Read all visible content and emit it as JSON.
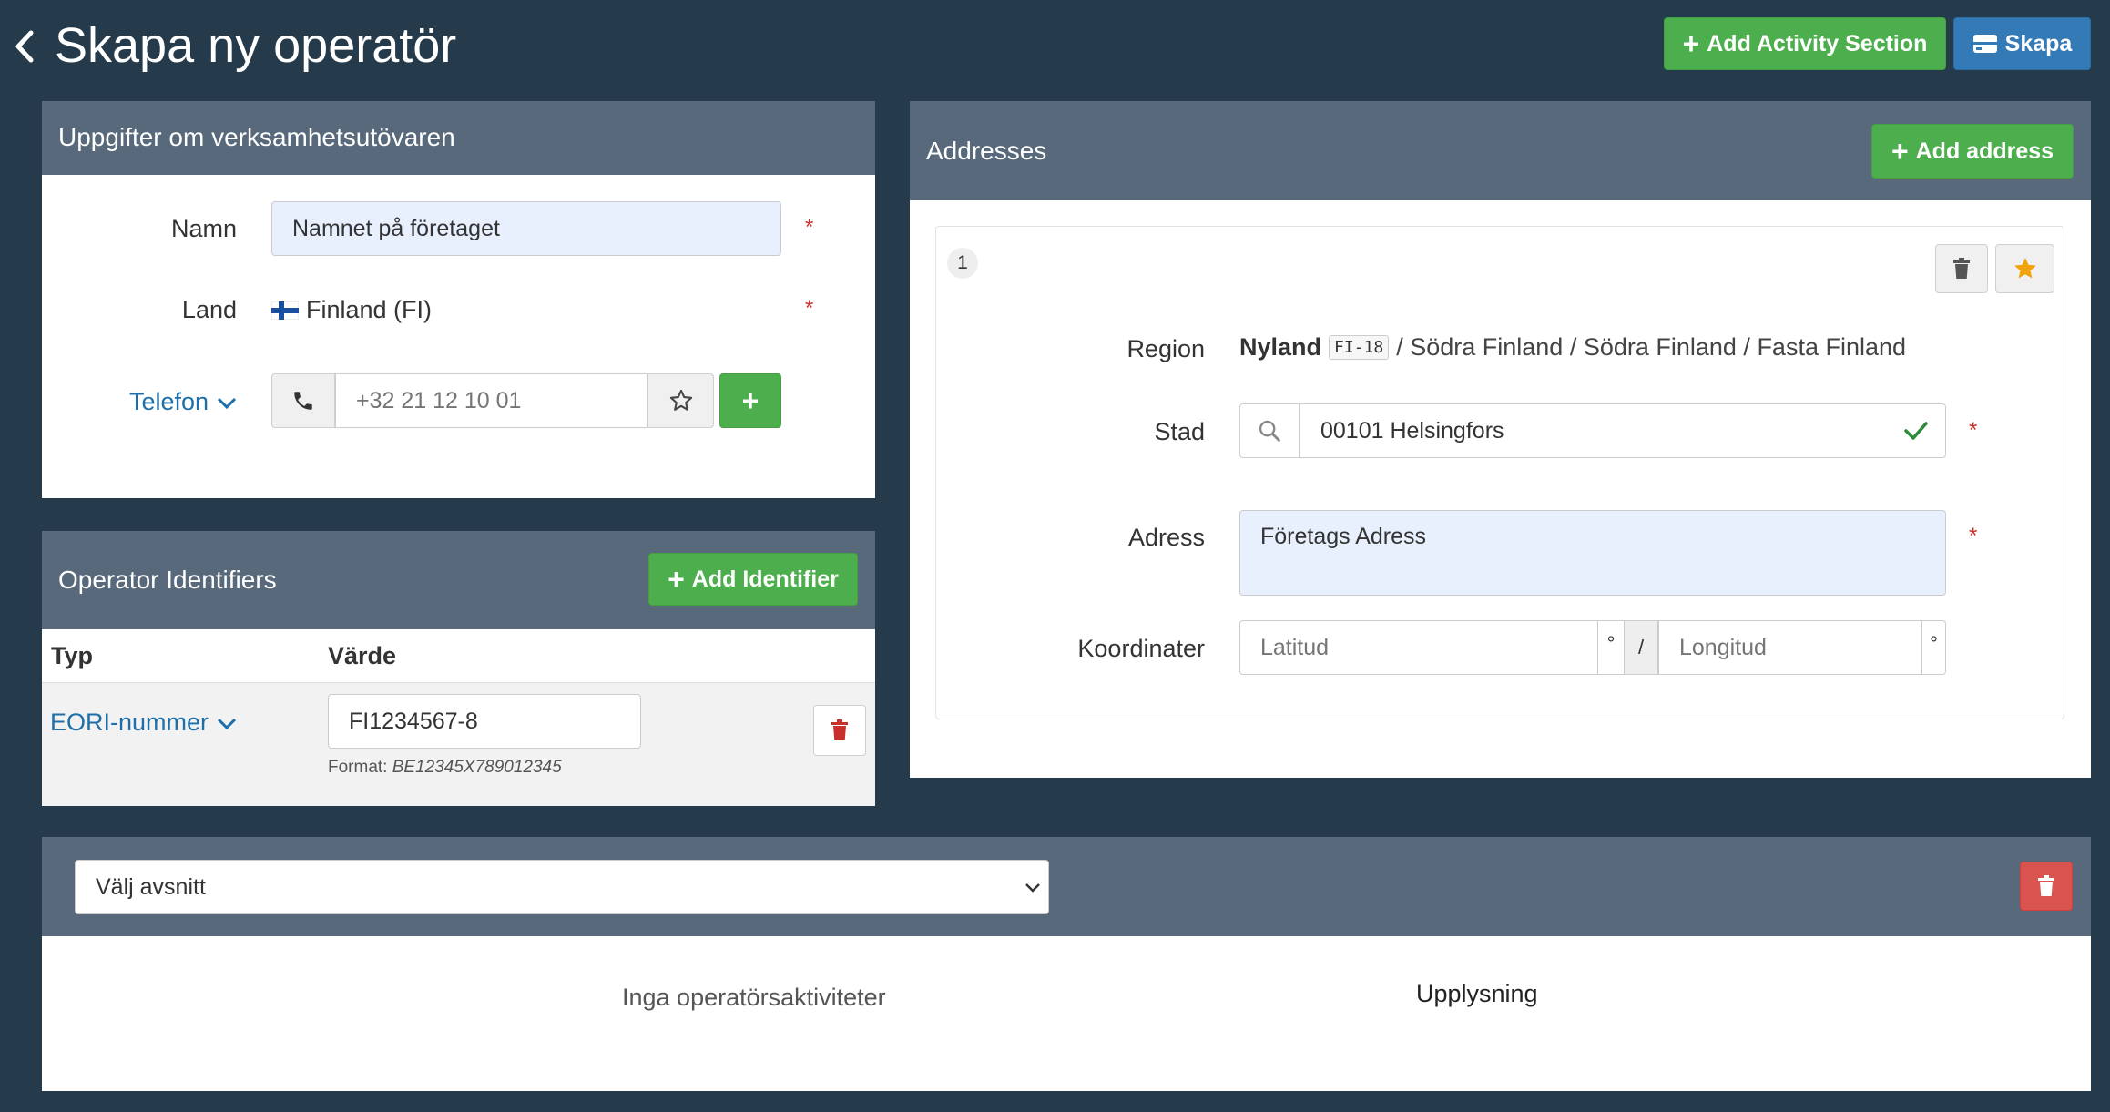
{
  "header": {
    "title": "Skapa ny operatör",
    "add_activity_label": "Add Activity Section",
    "create_label": "Skapa"
  },
  "operator": {
    "panel_title": "Uppgifter om verksamhetsutövaren",
    "name_label": "Namn",
    "name_value": "Namnet på företaget",
    "country_label": "Land",
    "country_value": "Finland (FI)",
    "phone_label": "Telefon",
    "phone_placeholder": "+32 21 12 10 01",
    "required_mark": "*"
  },
  "identifiers": {
    "panel_title": "Operator Identifiers",
    "add_label": "Add Identifier",
    "col_type": "Typ",
    "col_value": "Värde",
    "rows": [
      {
        "type": "EORI-nummer",
        "value": "FI1234567-8",
        "format_label": "Format:",
        "format_example": "BE12345X789012345"
      }
    ]
  },
  "addresses": {
    "panel_title": "Addresses",
    "add_label": "Add address",
    "items": [
      {
        "index": "1",
        "region_label": "Region",
        "region_name": "Nyland",
        "region_code": "FI-18",
        "region_path": "/ Södra Finland / Södra Finland / Fasta Finland",
        "city_label": "Stad",
        "city_value": "00101 Helsingfors",
        "address_label": "Adress",
        "address_value": "Företags Adress",
        "coords_label": "Koordinater",
        "lat_placeholder": "Latitud",
        "lon_placeholder": "Longitud",
        "degree": "°",
        "separator": "/"
      }
    ]
  },
  "section": {
    "select_value": "Välj avsnitt",
    "empty_text": "Inga operatörsaktiviteter",
    "info_text": "Upplysning"
  },
  "colors": {
    "background": "#253a4a",
    "panel_header": "#57697a",
    "green": "#4cae4c",
    "blue": "#337ab7",
    "red": "#d9534f",
    "link": "#1e6fa8",
    "star": "#f0a30a"
  }
}
